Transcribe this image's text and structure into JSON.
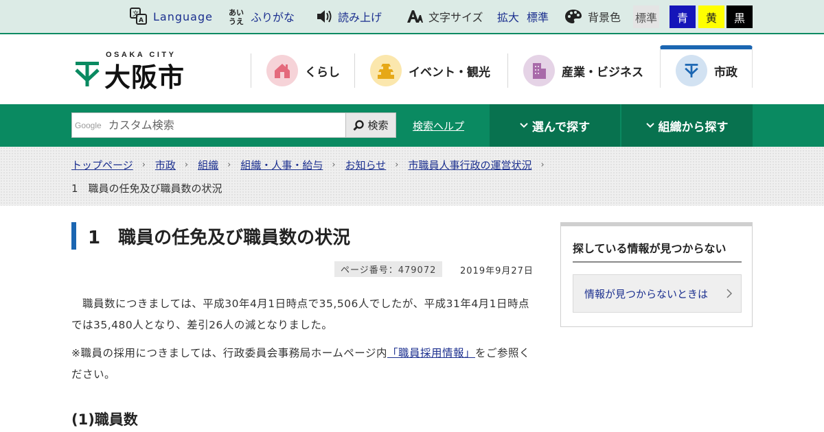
{
  "utility": {
    "language": "Language",
    "furigana": "ふりがな",
    "read_aloud": "読み上げ",
    "text_size": "文字サイズ",
    "zoom": "拡大",
    "standard_size": "標準",
    "background": "背景色",
    "bg_standard": "標準",
    "bg_blue": "青",
    "bg_yellow": "黄",
    "bg_black": "黒",
    "furigana_icon_glyphs": "あいうえ"
  },
  "logo": {
    "sub": "OSAKA CITY",
    "main": "大阪市"
  },
  "global_nav": [
    {
      "label": "くらし",
      "icon": "house-icon"
    },
    {
      "label": "イベント・観光",
      "icon": "castle-icon"
    },
    {
      "label": "産業・ビジネス",
      "icon": "building-icon"
    },
    {
      "label": "市政",
      "icon": "city-emblem-icon",
      "active": true
    }
  ],
  "search": {
    "brand": "Google",
    "placeholder": "カスタム検索",
    "button": "検索",
    "help": "検索ヘルプ",
    "choose": "選んで探す",
    "by_org": "組織から探す"
  },
  "breadcrumb": {
    "items": [
      "トップページ",
      "市政",
      "組織",
      "組織・人事・給与",
      "お知らせ",
      "市職員人事行政の運営状況"
    ],
    "current": "1　職員の任免及び職員数の状況"
  },
  "main": {
    "title": "1　職員の任免及び職員数の状況",
    "page_number": "ページ番号：479072",
    "date": "2019年9月27日",
    "paragraph1": "　職員数につきましては、平成30年4月1日時点で35,506人でしたが、平成31年4月1日時点では35,480人となり、差引26人の減となりました。",
    "paragraph2_before": "※職員の採用につきましては、行政委員会事務局ホームページ内",
    "paragraph2_link": "「職員採用情報」",
    "paragraph2_after": "をご参照ください。",
    "sub_heading": "(1)職員数"
  },
  "side": {
    "title": "探している情報が見つからない",
    "link": "情報が見つからないときは"
  },
  "colors": {
    "brand_green": "#0a8a61",
    "link_blue": "#1b2f8f",
    "accent_blue": "#1b66b2"
  }
}
